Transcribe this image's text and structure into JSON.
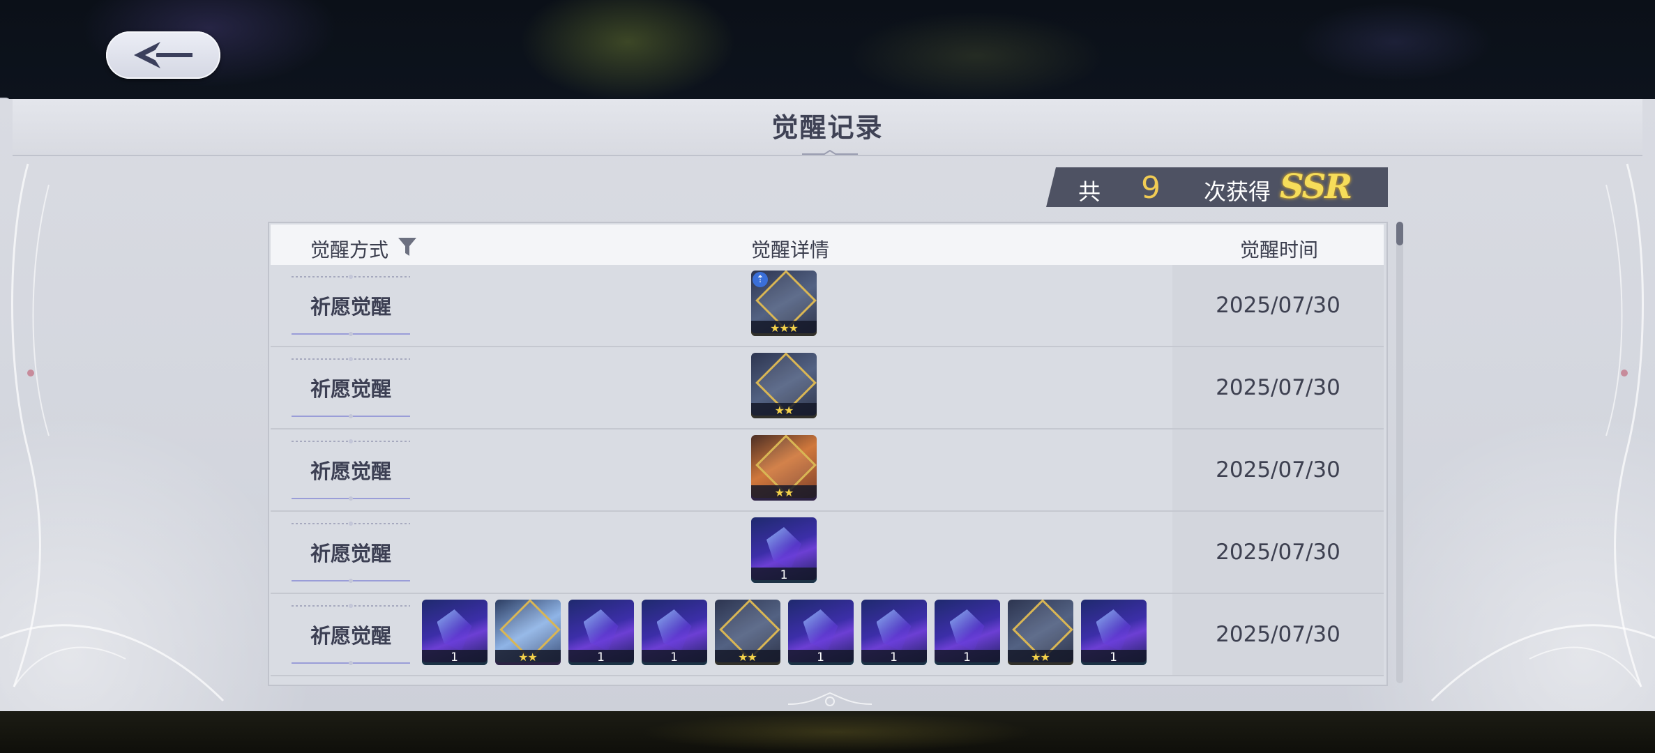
{
  "header": {
    "title": "觉醒记录",
    "back_label": "back"
  },
  "summary": {
    "prefix": "共",
    "count": "9",
    "suffix": "次获得",
    "rarity": "SSR"
  },
  "table": {
    "columns": [
      "觉醒方式",
      "觉醒详情",
      "觉醒时间"
    ],
    "rows": [
      {
        "method": "祈愿觉醒",
        "date": "2025/07/30",
        "items": [
          {
            "kind": "gold",
            "label": "★★★",
            "badge": true
          }
        ]
      },
      {
        "method": "祈愿觉醒",
        "date": "2025/07/30",
        "items": [
          {
            "kind": "gold",
            "label": "★★"
          }
        ]
      },
      {
        "method": "祈愿觉醒",
        "date": "2025/07/30",
        "items": [
          {
            "kind": "orange",
            "label": "★★"
          }
        ]
      },
      {
        "method": "祈愿觉醒",
        "date": "2025/07/30",
        "items": [
          {
            "kind": "card",
            "label": "1"
          }
        ]
      },
      {
        "method": "祈愿觉醒",
        "date": "2025/07/30",
        "items": [
          {
            "kind": "card",
            "label": "1"
          },
          {
            "kind": "ice",
            "label": "★★"
          },
          {
            "kind": "card",
            "label": "1"
          },
          {
            "kind": "card",
            "label": "1"
          },
          {
            "kind": "gold",
            "label": "★★"
          },
          {
            "kind": "card",
            "label": "1"
          },
          {
            "kind": "card",
            "label": "1"
          },
          {
            "kind": "card",
            "label": "1"
          },
          {
            "kind": "gold",
            "label": "★★"
          },
          {
            "kind": "card",
            "label": "1"
          }
        ]
      }
    ]
  },
  "colors": {
    "gold_accent": "#f1cc54",
    "panel_bg": "#d9dbe2",
    "banner_bg": "#4e5263"
  },
  "icons": {
    "back": "back-arrow-icon",
    "filter": "filter-funnel-icon"
  }
}
